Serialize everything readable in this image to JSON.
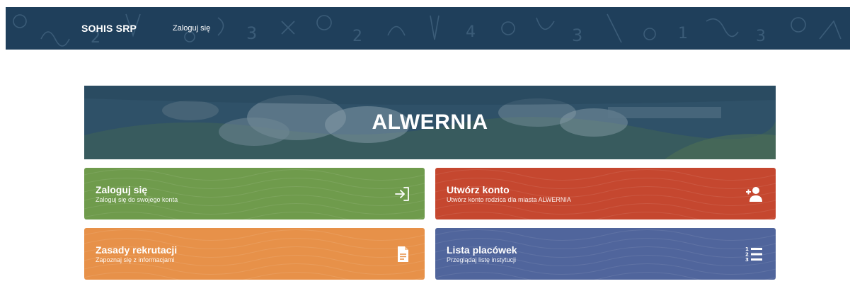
{
  "navbar": {
    "brand": "SOHIS SRP",
    "login_link": "Zaloguj się"
  },
  "hero": {
    "title": "ALWERNIA"
  },
  "tiles": [
    {
      "title": "Zaloguj się",
      "subtitle": "Zaloguj się do swojego konta",
      "icon": "sign-in-icon",
      "color": "#6f9b4c"
    },
    {
      "title": "Utwórz konto",
      "subtitle": "Utwórz konto rodzica dla miasta ALWERNIA",
      "icon": "add-user-icon",
      "color": "#c5472f"
    },
    {
      "title": "Zasady rekrutacji",
      "subtitle": "Zapoznaj się z informacjami",
      "icon": "document-icon",
      "color": "#e79149"
    },
    {
      "title": "Lista placówek",
      "subtitle": "Przeglądaj listę instytucji",
      "icon": "numbered-list-icon",
      "color": "#50659c"
    }
  ],
  "colors": {
    "navbar": "#1f3f5b",
    "hero_overlay": "#2d5068"
  }
}
